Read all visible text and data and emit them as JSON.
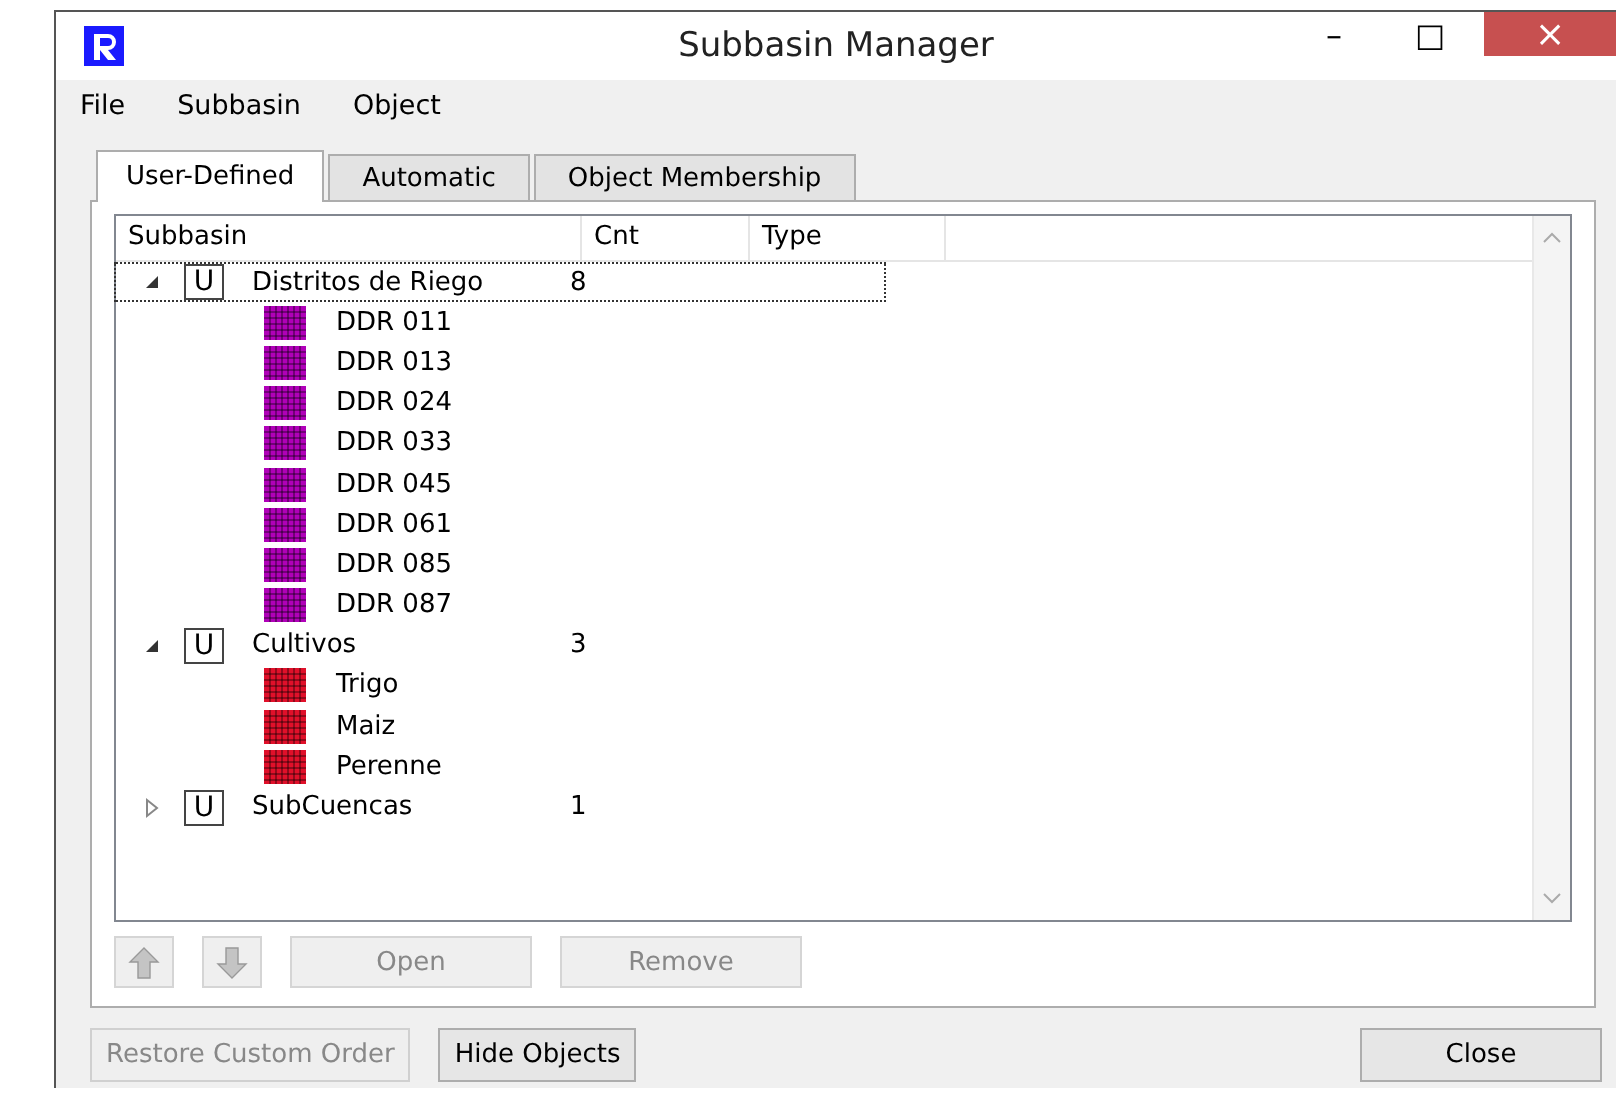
{
  "window": {
    "title": "Subbasin Manager",
    "controls": [
      "–",
      "□",
      "×"
    ]
  },
  "menu": [
    "File",
    "Subbasin",
    "Object"
  ],
  "tabs": [
    {
      "label": "User-Defined",
      "selected": true
    },
    {
      "label": "Automatic",
      "selected": false
    },
    {
      "label": "Object Membership",
      "selected": false
    }
  ],
  "tree": {
    "columns": [
      "Subbasin",
      "Cnt",
      "Type"
    ],
    "groups": [
      {
        "badge": "U",
        "name": "Distritos de Riego",
        "count": "8",
        "expanded": true,
        "selected": true,
        "children": [
          {
            "name": "DDR 011",
            "color": "#b000b8"
          },
          {
            "name": "DDR 013",
            "color": "#b000b8"
          },
          {
            "name": "DDR 024",
            "color": "#b000b8"
          },
          {
            "name": "DDR 033",
            "color": "#b000b8"
          },
          {
            "name": "DDR 045",
            "color": "#b000b8"
          },
          {
            "name": "DDR 061",
            "color": "#b000b8"
          },
          {
            "name": "DDR 085",
            "color": "#b000b8"
          },
          {
            "name": "DDR 087",
            "color": "#b000b8"
          }
        ]
      },
      {
        "badge": "U",
        "name": "Cultivos",
        "count": "3",
        "expanded": true,
        "selected": false,
        "children": [
          {
            "name": "Trigo",
            "color": "#e0102a"
          },
          {
            "name": "Maiz",
            "color": "#e0102a"
          },
          {
            "name": "Perenne",
            "color": "#e0102a"
          }
        ]
      },
      {
        "badge": "U",
        "name": "SubCuencas",
        "count": "1",
        "expanded": false,
        "selected": false
      }
    ]
  },
  "tree_buttons": [
    {
      "kind": "up",
      "disabled": true
    },
    {
      "kind": "down",
      "disabled": true
    },
    {
      "kind": "text",
      "label": "Open",
      "disabled": true
    },
    {
      "kind": "text",
      "label": "Remove",
      "disabled": true
    }
  ],
  "footer_buttons": [
    {
      "label": "Restore Custom Order",
      "disabled": true
    },
    {
      "label": "Hide Objects",
      "disabled": false
    },
    {
      "label": "Close",
      "disabled": false
    }
  ]
}
